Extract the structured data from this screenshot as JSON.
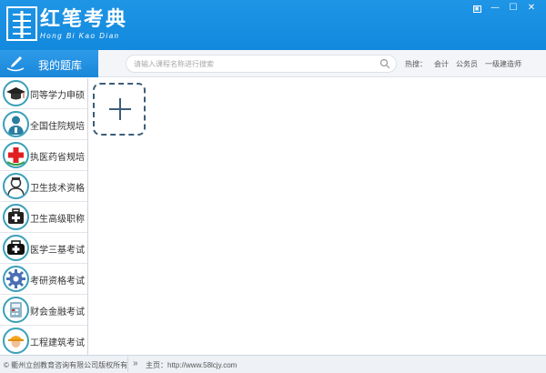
{
  "app": {
    "title_cn": "红笔考典",
    "title_pinyin": "Hong Bi Kao Dian",
    "accent": "#1289dd"
  },
  "window_controls": [
    "restore-icon",
    "minimize-icon",
    "maximize-icon",
    "close-icon"
  ],
  "window_glyphs": {
    "restore": "▣",
    "minimize": "—",
    "maximize": "☐",
    "close": "✕"
  },
  "header": {
    "my_bank_label": "我的题库",
    "search_placeholder": "请输入课程名称进行搜索",
    "hot_label": "热搜：",
    "hot_tags": [
      "会计",
      "公务员",
      "一级建造师"
    ]
  },
  "sidebar": {
    "items": [
      {
        "label": "同等学力申硕",
        "icon": "graduation-cap-icon"
      },
      {
        "label": "全国住院规培",
        "icon": "doctor-icon"
      },
      {
        "label": "执医药省规培",
        "icon": "red-cross-icon"
      },
      {
        "label": "卫生技术资格",
        "icon": "nurse-icon"
      },
      {
        "label": "卫生高级职称",
        "icon": "medical-kit-icon"
      },
      {
        "label": "医学三基考试",
        "icon": "first-aid-bag-icon"
      },
      {
        "label": "考研资格考试",
        "icon": "gear-icon"
      },
      {
        "label": "财会金融考试",
        "icon": "calculator-icon"
      },
      {
        "label": "工程建筑考试",
        "icon": "worker-helmet-icon"
      }
    ]
  },
  "main": {
    "add_card_icon": "plus-icon"
  },
  "footer": {
    "copyright": "© 衢州立创教育咨询有限公司版权所有",
    "home_label": "主页：",
    "home_url": "http://www.58lcjy.com"
  }
}
